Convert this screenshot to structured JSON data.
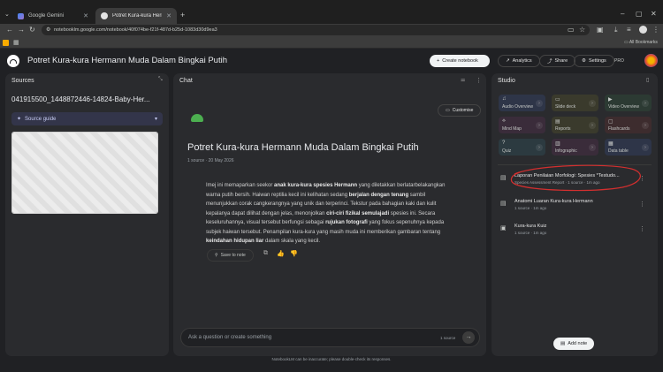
{
  "browser": {
    "tabs": [
      {
        "label": "Google Gemini",
        "active": false
      },
      {
        "label": "Potret Kura-kura Hermann Mu...",
        "active": true
      }
    ],
    "url": "notebooklm.google.com/notebook/40f074be-f21f-487d-b25d-1083d30d9ea3",
    "bookmarks_label": "All Bookmarks"
  },
  "appbar": {
    "title": "Potret Kura-kura Hermann Muda Dalam Bingkai Putih",
    "create_notebook": "Create notebook",
    "analytics": "Analytics",
    "share": "Share",
    "settings": "Settings",
    "plan_badge": "PRO"
  },
  "sources": {
    "header": "Sources",
    "source_name": "041915500_1448872446-14824-Baby-Her...",
    "source_guide": "Source guide"
  },
  "chat": {
    "header": "Chat",
    "customise": "Customise",
    "title": "Potret Kura-kura Hermann Muda Dalam Bingkai Putih",
    "meta": "1 source · 20 May 2026",
    "save_to_note": "Save to note",
    "input_placeholder": "Ask a question or create something",
    "source_count": "1 source"
  },
  "summary_html": "Imej ini memaparkan seekor <b>anak kura-kura spesies Hermann</b> yang diletakkan berlatarbelakangkan warna putih bersih. Haiwan reptilia kecil ini kelihatan sedang <b>berjalan dengan tenang</b> sambil menunjukkan corak cangkerangnya yang unik dan terperinci. Tekstur pada bahagian kaki dan kulit kepalanya dapat dilihat dengan jelas, menonjolkan <b>ciri-ciri fizikal semulajadi</b> spesies ini. Secara keseluruhannya, visual tersebut berfungsi sebagai <b>rujukan fotografi</b> yang fokus sepenuhnya kepada subjek haiwan tersebut. Penampilan kura-kura yang masih muda ini memberikan gambaran tentang <b>keindahan hidupan liar</b> dalam skala yang kecil.",
  "studio": {
    "header": "Studio",
    "cards": [
      {
        "label": "Audio Overview",
        "icon": "audio-icon",
        "color": "#2e3548"
      },
      {
        "label": "Slide deck",
        "icon": "slides-icon",
        "color": "#3a3a2c"
      },
      {
        "label": "Video Overview",
        "icon": "video-icon",
        "color": "#2c3a33"
      },
      {
        "label": "Mind Map",
        "icon": "mindmap-icon",
        "color": "#3a2c3a"
      },
      {
        "label": "Reports",
        "icon": "reports-icon",
        "color": "#3a3a2c"
      },
      {
        "label": "Flashcards",
        "icon": "flashcards-icon",
        "color": "#3d2c2e"
      },
      {
        "label": "Quiz",
        "icon": "quiz-icon",
        "color": "#2c3a40"
      },
      {
        "label": "Infographic",
        "icon": "infographic-icon",
        "color": "#3a2c3a"
      },
      {
        "label": "Data table",
        "icon": "table-icon",
        "color": "#2e3548"
      }
    ],
    "notes": [
      {
        "title": "Laporan Penilaian Morfologi: Spesies *Testudo...",
        "sub": "Species Assessment Report · 1 source · 1m ago"
      },
      {
        "title": "Anatomi Luaran Kura-kura Hermann",
        "sub": "1 source · 1m ago"
      },
      {
        "title": "Kura-kura Kuiz",
        "sub": "1 source · 1m ago"
      }
    ],
    "add_note": "Add note"
  },
  "footer": "NotebookLM can be inaccurate; please double-check its responses.",
  "colors": {
    "annotation": "#d32f2f",
    "accent": "#8ab4f8"
  }
}
